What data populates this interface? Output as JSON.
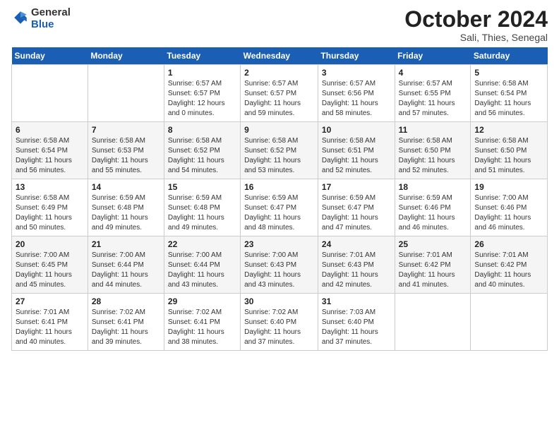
{
  "header": {
    "logo_general": "General",
    "logo_blue": "Blue",
    "month_title": "October 2024",
    "location": "Sali, Thies, Senegal"
  },
  "days_of_week": [
    "Sunday",
    "Monday",
    "Tuesday",
    "Wednesday",
    "Thursday",
    "Friday",
    "Saturday"
  ],
  "weeks": [
    [
      {
        "day": "",
        "info": ""
      },
      {
        "day": "",
        "info": ""
      },
      {
        "day": "1",
        "info": "Sunrise: 6:57 AM\nSunset: 6:57 PM\nDaylight: 12 hours and 0 minutes."
      },
      {
        "day": "2",
        "info": "Sunrise: 6:57 AM\nSunset: 6:57 PM\nDaylight: 11 hours and 59 minutes."
      },
      {
        "day": "3",
        "info": "Sunrise: 6:57 AM\nSunset: 6:56 PM\nDaylight: 11 hours and 58 minutes."
      },
      {
        "day": "4",
        "info": "Sunrise: 6:57 AM\nSunset: 6:55 PM\nDaylight: 11 hours and 57 minutes."
      },
      {
        "day": "5",
        "info": "Sunrise: 6:58 AM\nSunset: 6:54 PM\nDaylight: 11 hours and 56 minutes."
      }
    ],
    [
      {
        "day": "6",
        "info": "Sunrise: 6:58 AM\nSunset: 6:54 PM\nDaylight: 11 hours and 56 minutes."
      },
      {
        "day": "7",
        "info": "Sunrise: 6:58 AM\nSunset: 6:53 PM\nDaylight: 11 hours and 55 minutes."
      },
      {
        "day": "8",
        "info": "Sunrise: 6:58 AM\nSunset: 6:52 PM\nDaylight: 11 hours and 54 minutes."
      },
      {
        "day": "9",
        "info": "Sunrise: 6:58 AM\nSunset: 6:52 PM\nDaylight: 11 hours and 53 minutes."
      },
      {
        "day": "10",
        "info": "Sunrise: 6:58 AM\nSunset: 6:51 PM\nDaylight: 11 hours and 52 minutes."
      },
      {
        "day": "11",
        "info": "Sunrise: 6:58 AM\nSunset: 6:50 PM\nDaylight: 11 hours and 52 minutes."
      },
      {
        "day": "12",
        "info": "Sunrise: 6:58 AM\nSunset: 6:50 PM\nDaylight: 11 hours and 51 minutes."
      }
    ],
    [
      {
        "day": "13",
        "info": "Sunrise: 6:58 AM\nSunset: 6:49 PM\nDaylight: 11 hours and 50 minutes."
      },
      {
        "day": "14",
        "info": "Sunrise: 6:59 AM\nSunset: 6:48 PM\nDaylight: 11 hours and 49 minutes."
      },
      {
        "day": "15",
        "info": "Sunrise: 6:59 AM\nSunset: 6:48 PM\nDaylight: 11 hours and 49 minutes."
      },
      {
        "day": "16",
        "info": "Sunrise: 6:59 AM\nSunset: 6:47 PM\nDaylight: 11 hours and 48 minutes."
      },
      {
        "day": "17",
        "info": "Sunrise: 6:59 AM\nSunset: 6:47 PM\nDaylight: 11 hours and 47 minutes."
      },
      {
        "day": "18",
        "info": "Sunrise: 6:59 AM\nSunset: 6:46 PM\nDaylight: 11 hours and 46 minutes."
      },
      {
        "day": "19",
        "info": "Sunrise: 7:00 AM\nSunset: 6:46 PM\nDaylight: 11 hours and 46 minutes."
      }
    ],
    [
      {
        "day": "20",
        "info": "Sunrise: 7:00 AM\nSunset: 6:45 PM\nDaylight: 11 hours and 45 minutes."
      },
      {
        "day": "21",
        "info": "Sunrise: 7:00 AM\nSunset: 6:44 PM\nDaylight: 11 hours and 44 minutes."
      },
      {
        "day": "22",
        "info": "Sunrise: 7:00 AM\nSunset: 6:44 PM\nDaylight: 11 hours and 43 minutes."
      },
      {
        "day": "23",
        "info": "Sunrise: 7:00 AM\nSunset: 6:43 PM\nDaylight: 11 hours and 43 minutes."
      },
      {
        "day": "24",
        "info": "Sunrise: 7:01 AM\nSunset: 6:43 PM\nDaylight: 11 hours and 42 minutes."
      },
      {
        "day": "25",
        "info": "Sunrise: 7:01 AM\nSunset: 6:42 PM\nDaylight: 11 hours and 41 minutes."
      },
      {
        "day": "26",
        "info": "Sunrise: 7:01 AM\nSunset: 6:42 PM\nDaylight: 11 hours and 40 minutes."
      }
    ],
    [
      {
        "day": "27",
        "info": "Sunrise: 7:01 AM\nSunset: 6:41 PM\nDaylight: 11 hours and 40 minutes."
      },
      {
        "day": "28",
        "info": "Sunrise: 7:02 AM\nSunset: 6:41 PM\nDaylight: 11 hours and 39 minutes."
      },
      {
        "day": "29",
        "info": "Sunrise: 7:02 AM\nSunset: 6:41 PM\nDaylight: 11 hours and 38 minutes."
      },
      {
        "day": "30",
        "info": "Sunrise: 7:02 AM\nSunset: 6:40 PM\nDaylight: 11 hours and 37 minutes."
      },
      {
        "day": "31",
        "info": "Sunrise: 7:03 AM\nSunset: 6:40 PM\nDaylight: 11 hours and 37 minutes."
      },
      {
        "day": "",
        "info": ""
      },
      {
        "day": "",
        "info": ""
      }
    ]
  ]
}
